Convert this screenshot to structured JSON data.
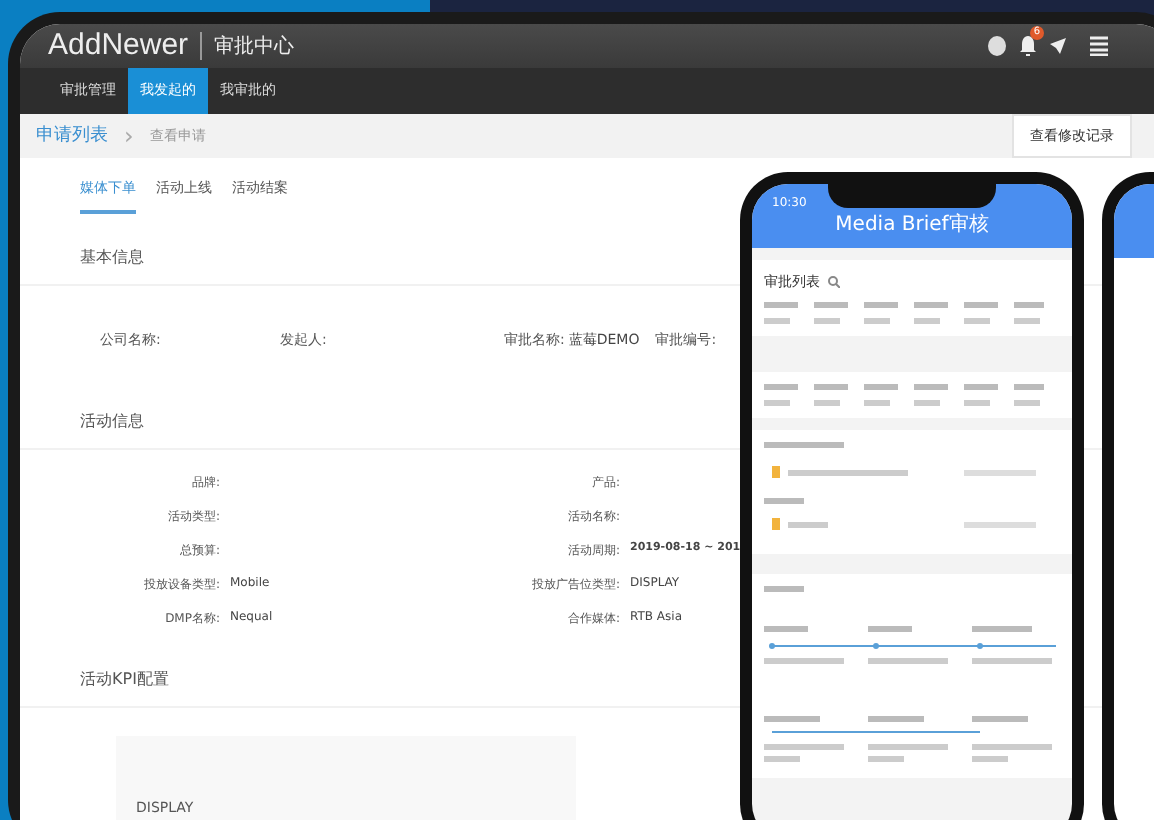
{
  "app": {
    "logo": "AddNewer",
    "title": "审批中心"
  },
  "nav_tabs": [
    {
      "label": "审批管理",
      "selected": false
    },
    {
      "label": "我发起的",
      "selected": true
    },
    {
      "label": "我审批的",
      "selected": false
    }
  ],
  "header_icons": {
    "notification_badge": "6"
  },
  "breadcrumb": [
    {
      "label": "申请列表",
      "link": true
    },
    {
      "label": "查看申请",
      "link": false
    }
  ],
  "breadcrumb_separator": "›",
  "history_button": "查看修改记录",
  "sub_tabs": [
    {
      "label": "媒体下单",
      "selected": true
    },
    {
      "label": "活动上线",
      "selected": false
    },
    {
      "label": "活动结案",
      "selected": false
    }
  ],
  "sections": [
    {
      "title": "基本信息",
      "fields": [
        {
          "label": "公司名称:"
        },
        {
          "label": "发起人:"
        },
        {
          "label": "审批名称:",
          "value": "蓝莓DEMO"
        },
        {
          "label": "审批编号:"
        }
      ]
    },
    {
      "title": "活动信息",
      "fields": [
        {
          "label": "品牌:"
        },
        {
          "label": "产品:"
        },
        {
          "label": "活动类型:"
        },
        {
          "label": "活动名称:"
        },
        {
          "label": "总预算:"
        },
        {
          "label": "活动周期:",
          "value": "2019-08-18 ~ 201"
        },
        {
          "label": "投放设备类型:",
          "value": "Mobile"
        },
        {
          "label": "投放广告位类型:",
          "value": "DISPLAY"
        },
        {
          "label": "DMP名称:",
          "value": "Nequal"
        },
        {
          "label": "合作媒体:",
          "value": "RTB Asia"
        }
      ]
    },
    {
      "title": "活动KPI配置",
      "card": "DISPLAY"
    }
  ],
  "phone": {
    "time": "10:30",
    "title": "Media Brief审核",
    "list_title": "审批列表"
  }
}
